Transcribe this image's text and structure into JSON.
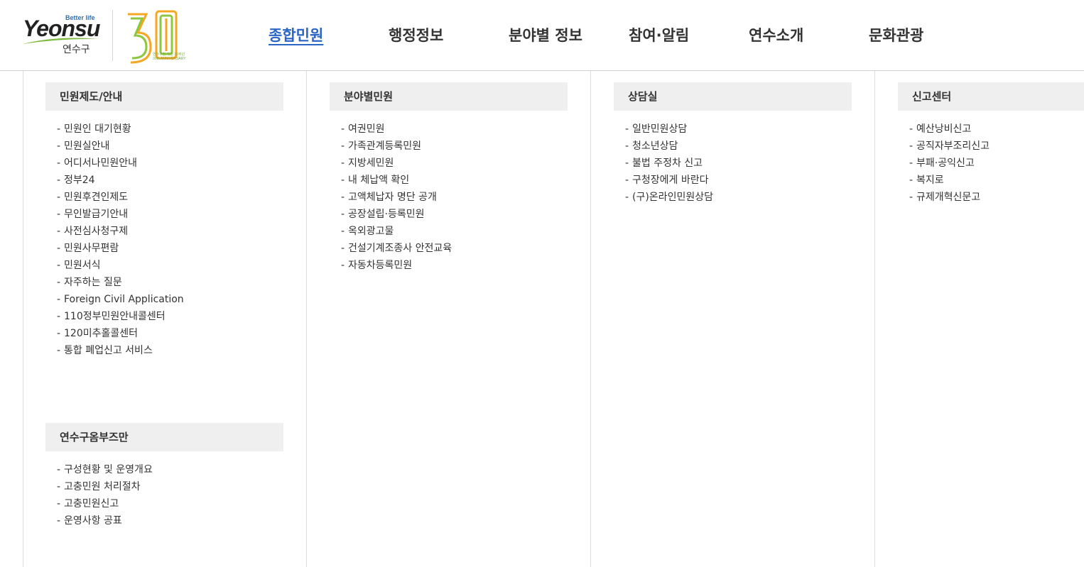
{
  "header": {
    "logo": {
      "tagline": "Better life",
      "wordmark": "Yeonsu",
      "name_ko": "연수구",
      "anniversary_number": "30",
      "anniversary_text": "연수구청 개청 30주년",
      "anniversary_en": "30th ANNIVERSARY"
    },
    "nav": [
      {
        "label": "종합민원"
      },
      {
        "label": "행정정보"
      },
      {
        "label": "분야별 정보"
      },
      {
        "label": "참여·알림"
      },
      {
        "label": "연수소개"
      },
      {
        "label": "문화관광"
      }
    ],
    "active_nav": "종합민원",
    "accent_color": "#2a64c4"
  },
  "menu": {
    "col1": {
      "title": "민원제도/안내",
      "items": [
        "민원인 대기현황",
        "민원실안내",
        "어디서나민원안내",
        "정부24",
        "민원후견인제도",
        "무인발급기안내",
        "사전심사청구제",
        "민원사무편람",
        "민원서식",
        "자주하는 질문",
        "Foreign Civil Application",
        "110정부민원안내콜센터",
        "120미추홀콜센터",
        "통합 폐업신고 서비스"
      ]
    },
    "col1b": {
      "title": "연수구옴부즈만",
      "items": [
        "구성현황 및 운영개요",
        "고충민원 처리절차",
        "고충민원신고",
        "운영사항 공표"
      ]
    },
    "col2": {
      "title": "분야별민원",
      "items": [
        "여권민원",
        "가족관계등록민원",
        "지방세민원",
        "내 체납액 확인",
        "고액체납자 명단 공개",
        "공장설립·등록민원",
        "옥외광고물",
        "건설기계조종사 안전교육",
        "자동차등록민원"
      ]
    },
    "col3": {
      "title": "상담실",
      "items": [
        "일반민원상담",
        "청소년상담",
        "불법 주정차 신고",
        "구청장에게 바란다",
        "(구)온라인민원상담"
      ]
    },
    "col4": {
      "title": "신고센터",
      "items": [
        "예산낭비신고",
        "공직자부조리신고",
        "부패·공익신고",
        "복지로",
        "규제개혁신문고"
      ]
    },
    "item_prefix": "-"
  }
}
